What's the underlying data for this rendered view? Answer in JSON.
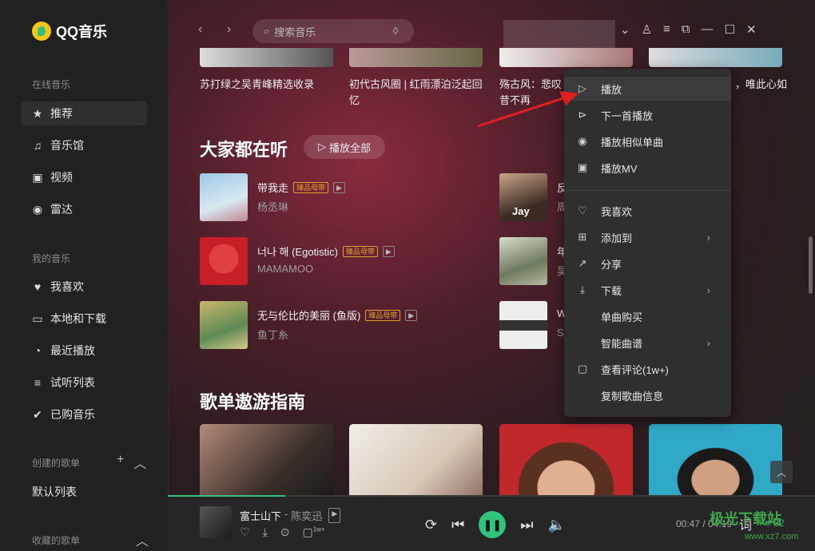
{
  "app": {
    "name": "QQ音乐"
  },
  "sidebar": {
    "group_online": "在线音乐",
    "online_items": [
      {
        "label": "推荐",
        "icon": "star-icon"
      },
      {
        "label": "音乐馆",
        "icon": "music-note-icon"
      },
      {
        "label": "视频",
        "icon": "video-icon"
      },
      {
        "label": "雷达",
        "icon": "radar-icon"
      }
    ],
    "group_mine": "我的音乐",
    "mine_items": [
      {
        "label": "我喜欢",
        "icon": "heart-icon"
      },
      {
        "label": "本地和下载",
        "icon": "monitor-icon"
      },
      {
        "label": "最近播放",
        "icon": "clock-icon"
      },
      {
        "label": "试听列表",
        "icon": "playlist-icon"
      },
      {
        "label": "已购音乐",
        "icon": "check-circle-icon"
      }
    ],
    "group_created": "创建的歌单",
    "created_items": [
      "默认列表"
    ],
    "group_collected": "收藏的歌单"
  },
  "search": {
    "placeholder": "搜索音乐"
  },
  "playlists_top": [
    {
      "title": "苏打绿之吴青峰精选收录"
    },
    {
      "title": "初代古风圈 | 红雨漂泊泛起回忆"
    },
    {
      "title": "殇古风：悲叹昔不再"
    },
    {
      "title": "，唯此心如"
    }
  ],
  "section_listening": {
    "title": "大家都在听",
    "play_all": "播放全部"
  },
  "songs": [
    {
      "name": "带我走",
      "artist": "杨丞琳",
      "badge": "臻品母带"
    },
    {
      "name": "너나 해 (Egotistic)",
      "artist": "MAMAMOO",
      "badge": "臻品母带"
    },
    {
      "name": "无与伦比的美丽 (鱼版)",
      "artist": "鱼丁糸",
      "badge": "臻品母带"
    },
    {
      "name": "反",
      "artist": "周",
      "cover_text": "Jay"
    },
    {
      "name": "年",
      "artist": "吴"
    },
    {
      "name": "W",
      "artist": "S"
    }
  ],
  "section_playlists": {
    "title": "歌单遨游指南"
  },
  "context_menu": {
    "items": [
      {
        "label": "播放",
        "icon": "play-icon"
      },
      {
        "label": "下一首播放",
        "icon": "next-play-icon"
      },
      {
        "label": "播放相似单曲",
        "icon": "radar-icon"
      },
      {
        "label": "播放MV",
        "icon": "mv-icon"
      },
      {
        "label": "我喜欢",
        "icon": "heart-icon"
      },
      {
        "label": "添加到",
        "icon": "plus-box-icon",
        "submenu": true
      },
      {
        "label": "分享",
        "icon": "share-icon"
      },
      {
        "label": "下载",
        "icon": "download-icon",
        "submenu": true
      },
      {
        "label": "单曲购买",
        "icon": ""
      },
      {
        "label": "智能曲谱",
        "icon": "",
        "submenu": true
      },
      {
        "label": "查看评论(1w+)",
        "icon": "comment-icon"
      },
      {
        "label": "复制歌曲信息",
        "icon": ""
      }
    ]
  },
  "player": {
    "title": "富士山下",
    "artist": "陈奕迅",
    "comment_count": "1w+",
    "time_current": "00:47",
    "time_total": "04:19",
    "lyric_label": "词",
    "queue_count": "32",
    "progress": 0.181
  },
  "watermark": {
    "main": "极光下载站",
    "sub": "www.xz7.com"
  },
  "colors": {
    "accent": "#31c27c",
    "badge": "#e0a030",
    "arrow": "#e02020"
  }
}
